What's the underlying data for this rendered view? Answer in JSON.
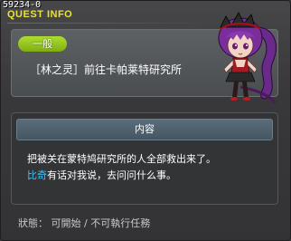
{
  "quest_id": "59234-0",
  "title": "QUEST INFO",
  "quest": {
    "category": "一般",
    "name": "［林之灵］前往卡帕莱特研究所"
  },
  "content": {
    "header": "内容",
    "line1": "把被关在蒙特鸠研究所的人全部救出来了。",
    "line2_highlight": "比奇",
    "line2_rest": "有话对我说，去问问什么事。"
  },
  "status": "狀態： 可開始 / 不可執行任務",
  "colors": {
    "title": "#e8e23a",
    "tag": "#9acb22",
    "highlight": "#3ec3ff"
  }
}
